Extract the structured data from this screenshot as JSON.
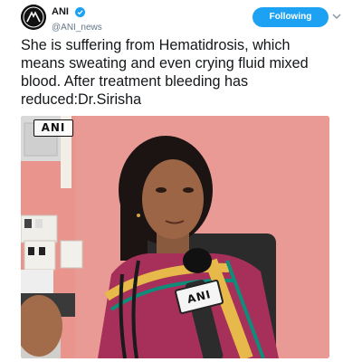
{
  "account": {
    "name": "ANI",
    "handle": "@ANI_news",
    "avatar_text": "ANI",
    "verified_icon": "verified-badge-icon"
  },
  "follow_button": {
    "label": "Following"
  },
  "more_icon": "chevron-down-icon",
  "tweet": {
    "text": "She is suffering from Hematidrosis, which means sweating and even crying fluid mixed blood. After treatment bleeding has reduced:Dr.Sirisha"
  },
  "media": {
    "watermark": "ANI",
    "mic_label": "ANI"
  },
  "colors": {
    "accent": "#1da1f2",
    "text": "#14171a",
    "muted": "#657786",
    "wall": "#e8958f"
  }
}
